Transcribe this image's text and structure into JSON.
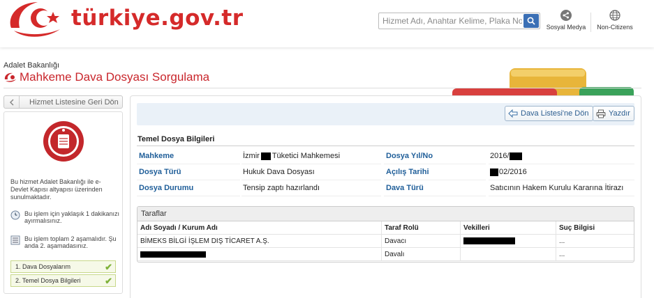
{
  "header": {
    "logo_text": "türkiye.gov.tr",
    "search_placeholder": "Hizmet Adı, Anahtar Kelime, Plaka No...",
    "social_label": "Sosyal Medya",
    "noncitizens_label": "Non-Citizens"
  },
  "page": {
    "ministry": "Adalet Bakanlığı",
    "title": "Mahkeme Dava Dosyası Sorgulama"
  },
  "sidebar": {
    "back_label": "Hizmet Listesine Geri Dön",
    "description": "Bu hizmet Adalet Bakanlığı ile e-Devlet Kapısı altyapısı üzerinden sunulmaktadır.",
    "time_info": "Bu işlem için yaklaşık 1 dakikanızı ayırmalısınız.",
    "steps_info": "Bu işlem toplam 2 aşamalıdır. Şu anda 2. aşamadasınız.",
    "steps": [
      {
        "label": "1. Dava Dosyalarım"
      },
      {
        "label": "2. Temel Dosya Bilgileri"
      }
    ]
  },
  "toolbar": {
    "back_to_list": "Dava Listesi'ne Dön",
    "print": "Yazdır"
  },
  "basic_info": {
    "section_title": "Temel Dosya Bilgileri",
    "rows": [
      {
        "label1": "Mahkeme",
        "value1_pre": "İzmir",
        "value1_post": "Tüketici Mahkemesi",
        "label2": "Dosya Yıl/No",
        "value2_pre": "2016/",
        "value2_post": ""
      },
      {
        "label1": "Dosya Türü",
        "value1_pre": "Hukuk Dava Dosyası",
        "value1_post": "",
        "label2": "Açılış Tarihi",
        "value2_pre": "",
        "value2_post": "02/2016"
      },
      {
        "label1": "Dosya Durumu",
        "value1_pre": "Tensip zaptı hazırlandı",
        "value1_post": "",
        "label2": "Dava Türü",
        "value2_pre": "Satıcının Hakem Kurulu Kararına İtirazı",
        "value2_post": ""
      }
    ]
  },
  "parties": {
    "section_title": "Taraflar",
    "columns": [
      "Adı Soyadı / Kurum Adı",
      "Taraf Rolü",
      "Vekilleri",
      "Suç Bilgisi"
    ],
    "rows": [
      {
        "name": "BİMEKS BİLGİ İŞLEM DIŞ TİCARET A.Ş.",
        "role": "Davacı",
        "lawyers": "",
        "crime": "..."
      },
      {
        "name": "",
        "role": "Davalı",
        "lawyers": "",
        "crime": "..."
      }
    ]
  },
  "colors": {
    "brand_red": "#d52a2a",
    "link_blue": "#1f5e99",
    "search_button": "#3a6fb5",
    "step_check": "#7fb23a"
  }
}
